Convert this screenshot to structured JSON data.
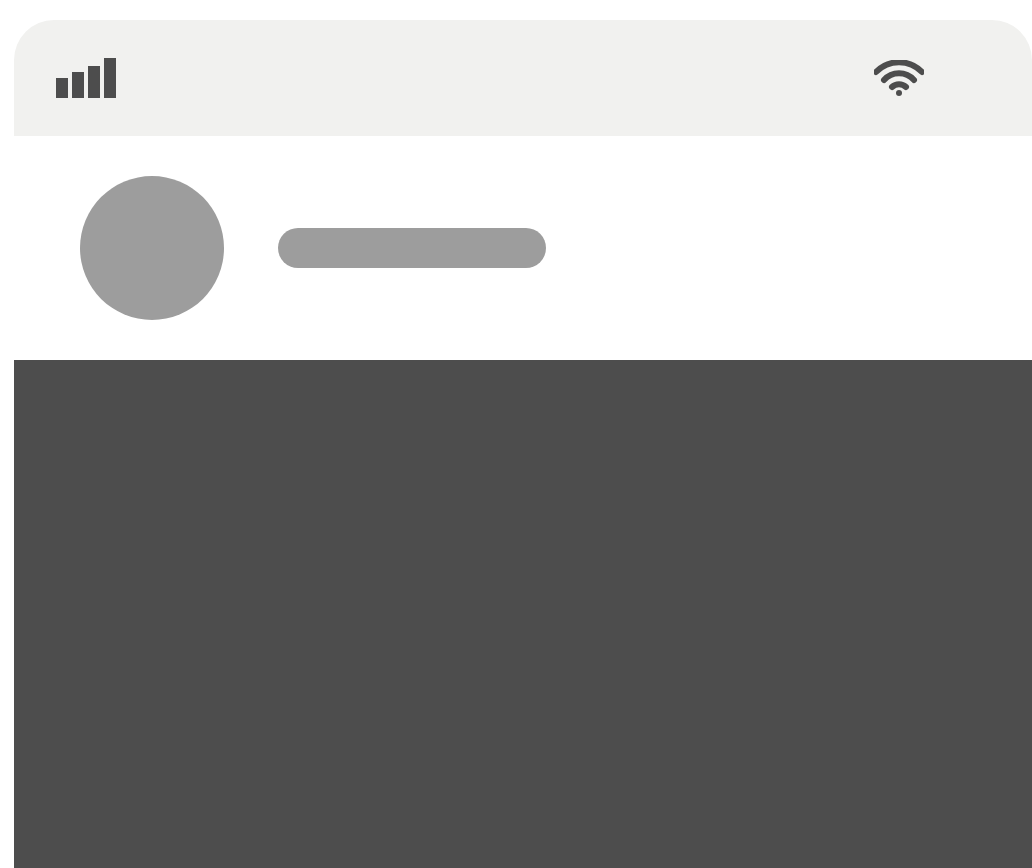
{
  "media": {
    "kind": "placeholder"
  }
}
